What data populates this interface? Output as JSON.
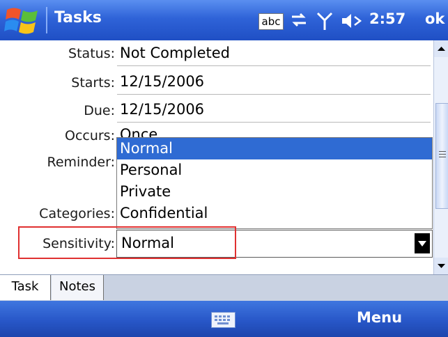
{
  "titlebar": {
    "title": "Tasks",
    "input_indicator": "abc",
    "clock": "2:57",
    "ok_label": "ok",
    "icons": [
      "windows-start-icon",
      "connectivity-icon",
      "signal-icon",
      "volume-icon"
    ]
  },
  "form": {
    "status": {
      "label": "Status:",
      "value": "Not Completed"
    },
    "starts": {
      "label": "Starts:",
      "value": "12/15/2006"
    },
    "due": {
      "label": "Due:",
      "value": "12/15/2006"
    },
    "occurs": {
      "label": "Occurs:",
      "value": "Once"
    },
    "reminder": {
      "label": "Reminder:"
    },
    "categories": {
      "label": "Categories:"
    },
    "sensitivity": {
      "label": "Sensitivity:",
      "value": "Normal"
    }
  },
  "sensitivity_options": [
    "Normal",
    "Personal",
    "Private",
    "Confidential"
  ],
  "sensitivity_selected_index": 0,
  "tabs": [
    "Task",
    "Notes"
  ],
  "bottombar": {
    "menu_label": "Menu"
  },
  "colors": {
    "titlebar": "#2f63d8",
    "selection": "#2f6bd3",
    "highlight_box": "#e03030"
  }
}
